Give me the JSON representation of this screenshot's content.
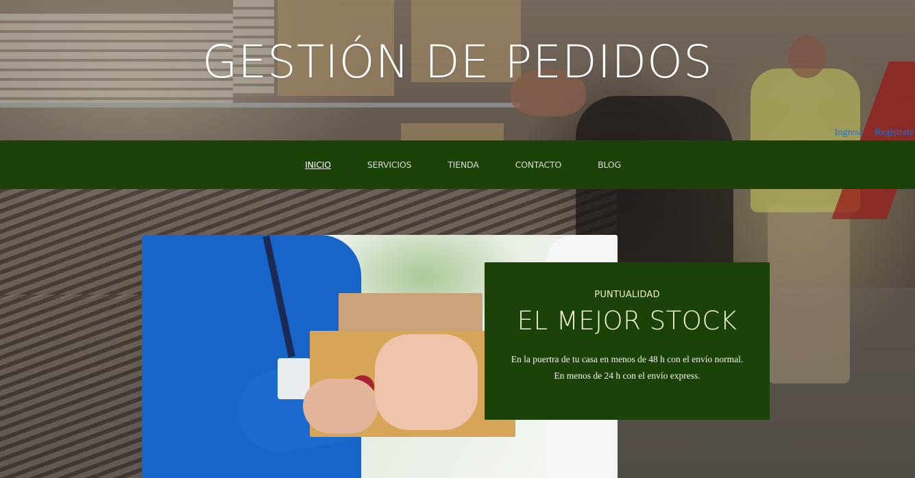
{
  "header": {
    "title": "GESTIÓN DE PEDIDOS",
    "auth": {
      "login_label": "Ingresa",
      "register_label": "Registrate"
    }
  },
  "nav": {
    "items": [
      {
        "label": "INICIO",
        "active": true
      },
      {
        "label": "SERVICIOS",
        "active": false
      },
      {
        "label": "TIENDA",
        "active": false
      },
      {
        "label": "CONTACTO",
        "active": false
      },
      {
        "label": "BLOG",
        "active": false
      }
    ]
  },
  "feature": {
    "eyebrow": "PUNTUALIDAD",
    "heading": "EL MEJOR STOCK",
    "text": "En la puertra de tu casa en menos de 48 h con el envío normal. En menos de 24 h con el envío express."
  },
  "colors": {
    "nav_bg": "#1b4308",
    "card_bg": "#1b4308",
    "link": "#1e6fd9"
  }
}
